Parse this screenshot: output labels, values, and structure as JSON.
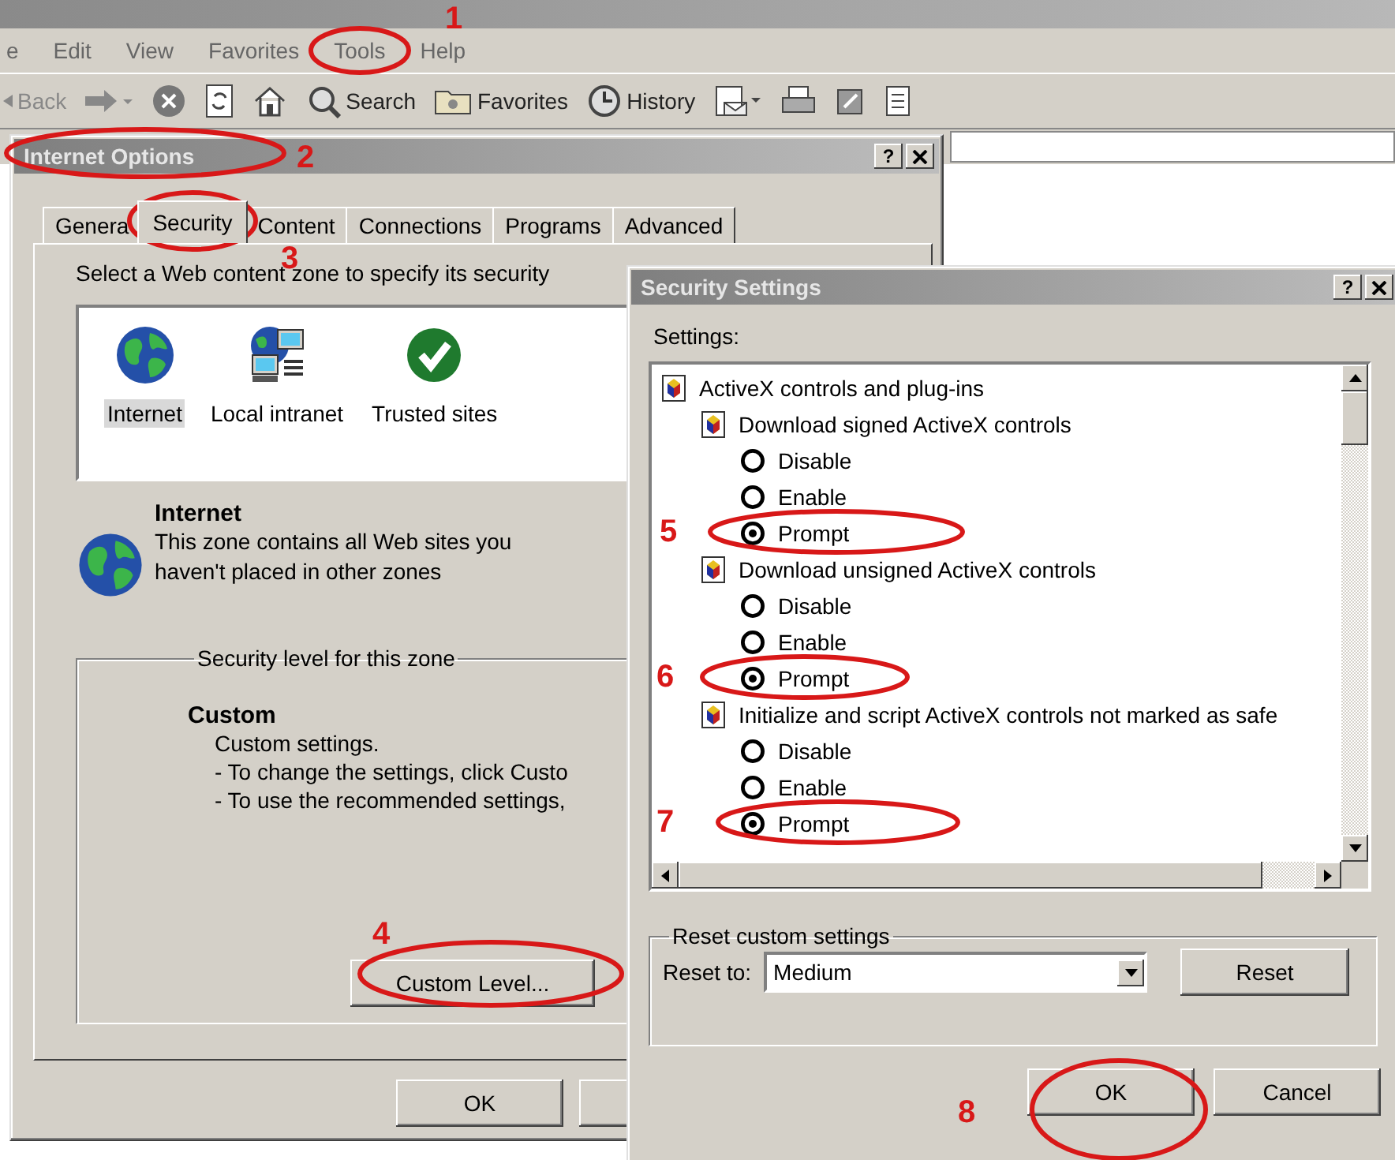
{
  "browser": {
    "menu": [
      "e",
      "Edit",
      "View",
      "Favorites",
      "Tools",
      "Help"
    ],
    "toolbar": [
      {
        "kind": "back",
        "label": "Back"
      },
      {
        "kind": "forward"
      },
      {
        "kind": "stop"
      },
      {
        "kind": "refresh"
      },
      {
        "kind": "home"
      },
      {
        "kind": "search",
        "label": "Search"
      },
      {
        "kind": "favorites",
        "label": "Favorites"
      },
      {
        "kind": "history",
        "label": "History"
      },
      {
        "kind": "mail"
      },
      {
        "kind": "print"
      },
      {
        "kind": "edit"
      },
      {
        "kind": "page"
      }
    ]
  },
  "internet_options": {
    "title": "Internet Options",
    "help": "?",
    "tabs": [
      {
        "label": "Genera",
        "selected": false
      },
      {
        "label": "Security",
        "selected": true
      },
      {
        "label": "Content",
        "selected": false
      },
      {
        "label": "Connections",
        "selected": false
      },
      {
        "label": "Programs",
        "selected": false
      },
      {
        "label": "Advanced",
        "selected": false
      }
    ],
    "zone_prompt": "Select a Web content zone to specify its security",
    "zones": [
      {
        "kind": "internet",
        "label": "Internet",
        "selected": true
      },
      {
        "kind": "intranet",
        "label": "Local intranet",
        "selected": false
      },
      {
        "kind": "trusted",
        "label": "Trusted sites",
        "selected": false
      }
    ],
    "zone_name": "Internet",
    "zone_description": "This zone contains all Web sites you haven't placed in other zones",
    "level_group": "Security level for this zone",
    "level_name": "Custom",
    "level_lines": [
      "Custom settings.",
      "- To change the settings, click Custo",
      "- To use the recommended settings,"
    ],
    "custom_level_button": "Custom Level...",
    "ok_button": "OK"
  },
  "security_settings": {
    "title": "Security Settings",
    "help": "?",
    "settings_label": "Settings:",
    "tree": [
      {
        "kind": "group",
        "label": "ActiveX controls and plug-ins",
        "children": [
          {
            "kind": "group",
            "label": "Download signed ActiveX controls",
            "children": [
              {
                "kind": "option",
                "label": "Disable",
                "selected": false
              },
              {
                "kind": "option",
                "label": "Enable",
                "selected": false
              },
              {
                "kind": "option",
                "label": "Prompt",
                "selected": true
              }
            ]
          },
          {
            "kind": "group",
            "label": "Download unsigned ActiveX controls",
            "children": [
              {
                "kind": "option",
                "label": "Disable",
                "selected": false
              },
              {
                "kind": "option",
                "label": "Enable",
                "selected": false
              },
              {
                "kind": "option",
                "label": "Prompt",
                "selected": true
              }
            ]
          },
          {
            "kind": "group",
            "label": "Initialize and script ActiveX controls not marked as safe",
            "children": [
              {
                "kind": "option",
                "label": "Disable",
                "selected": false
              },
              {
                "kind": "option",
                "label": "Enable",
                "selected": false
              },
              {
                "kind": "option",
                "label": "Prompt",
                "selected": true
              }
            ]
          }
        ]
      }
    ],
    "reset_group": "Reset custom settings",
    "reset_label": "Reset to:",
    "reset_value": "Medium",
    "reset_button": "Reset",
    "buttons": [
      "OK",
      "Cancel"
    ]
  },
  "annotations": [
    {
      "number": "1"
    },
    {
      "number": "2"
    },
    {
      "number": "3"
    },
    {
      "number": "4"
    },
    {
      "number": "5"
    },
    {
      "number": "6"
    },
    {
      "number": "7"
    },
    {
      "number": "8"
    }
  ]
}
